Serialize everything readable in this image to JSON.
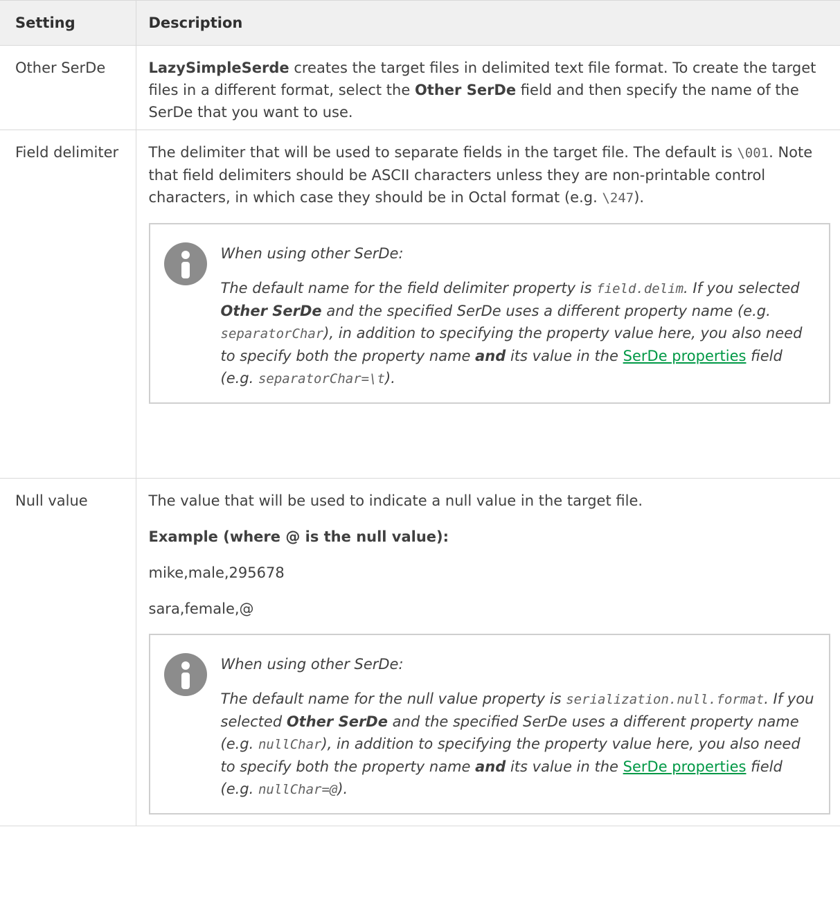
{
  "header": {
    "setting": "Setting",
    "description": "Description"
  },
  "rows": {
    "other_serde": {
      "name": "Other SerDe",
      "d_b1": "LazySimpleSerde",
      "d_t1": " creates the target files in delimited text file format. To create the target files in a different format, select the ",
      "d_b2": "Other SerDe",
      "d_t2": " field and then specify the name of the SerDe that you want to use."
    },
    "field_delimiter": {
      "name": "Field delimiter",
      "d_t1": "The delimiter that will be used to separate fields in the target file. The default is ",
      "d_c1": "\\001",
      "d_t2": ". Note that field delimiters should be ASCII characters unless they are non-printable control characters, in which case they should be in Octal format (e.g. ",
      "d_c2": "\\247",
      "d_t3": ").",
      "note": {
        "title": "When using other SerDe:",
        "t1": "The default name for the field delimiter property is ",
        "c1": "field.delim",
        "t2": ". If you selected ",
        "b1": "Other SerDe",
        "t3": " and the specified SerDe uses a different property name (e.g. ",
        "c2": "separatorChar",
        "t4": "), in addition to specifying the property value here, you also need to specify both the property name ",
        "b2": "and",
        "t5": " its value in the ",
        "link": "SerDe properties",
        "t6": " field (e.g. ",
        "c3": "separatorChar=\\t",
        "t7": ")."
      }
    },
    "null_value": {
      "name": "Null value",
      "d_p1": "The value that will be used to indicate a null value in the target file.",
      "d_p2": "Example (where @ is the null value):",
      "d_p3": "mike,male,295678",
      "d_p4": "sara,female,@",
      "note": {
        "title": "When using other SerDe:",
        "t1": "The default name for the null value property is ",
        "c1": "serialization.null.format",
        "t2": ". If you selected ",
        "b1": "Other SerDe",
        "t3": " and the specified SerDe uses a different property name (e.g. ",
        "c2": "nullChar",
        "t4": "), in addition to specifying the property value here, you also need to specify both the property name ",
        "b2": "and",
        "t5": " its value in the ",
        "link": "SerDe properties",
        "t6": " field (e.g. ",
        "c3": "nullChar=@",
        "t7": ")."
      }
    }
  }
}
